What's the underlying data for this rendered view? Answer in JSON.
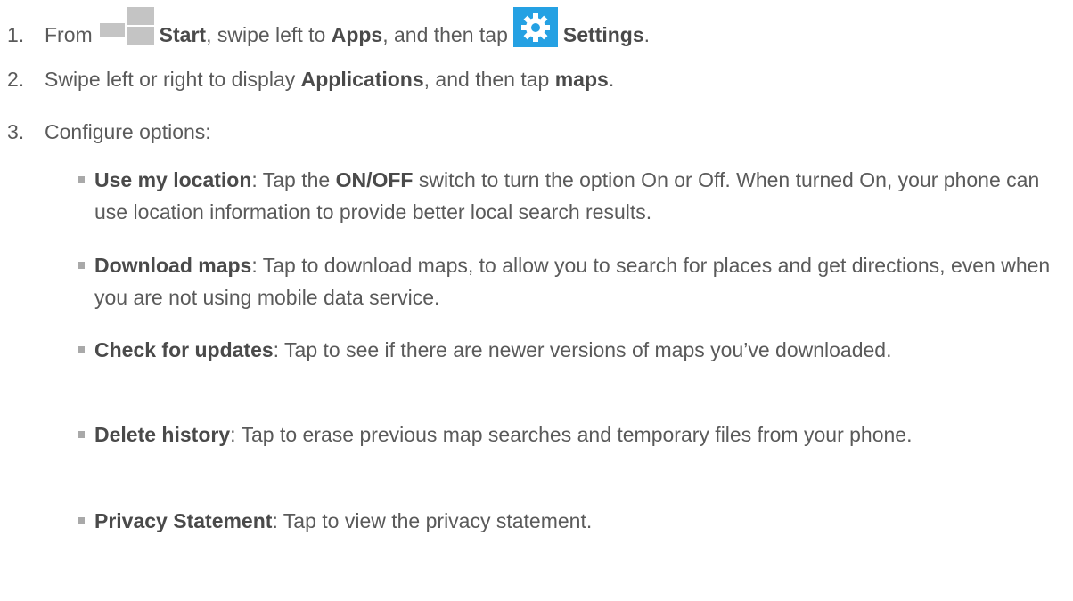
{
  "steps": [
    {
      "num": "1.",
      "t1": "From",
      "start": "Start",
      "t2": ", swipe left to",
      "apps": "Apps",
      "t3": ", and then tap",
      "settings": "Settings",
      "t4": "."
    },
    {
      "num": "2.",
      "t1": "Swipe left or right to display",
      "applications": "Applications",
      "t2": ", and then tap",
      "maps": "maps",
      "t3": "."
    },
    {
      "num": "3.",
      "t1": "Configure options:"
    }
  ],
  "options": [
    {
      "title": "Use my location",
      "pre": ": Tap the",
      "bold2": "ON/OFF",
      "desc": "switch to turn the option On or Off. When turned On, your phone can use location information to provide better local search results."
    },
    {
      "title": "Download maps",
      "desc": ": Tap to download maps, to allow you to search for places and get directions, even when you are not using mobile data service."
    },
    {
      "title": "Check for updates",
      "desc": ": Tap to see if there are newer versions of maps you’ve downloaded."
    },
    {
      "title": "Delete history",
      "desc": ": Tap to erase previous map searches and temporary files from your phone."
    },
    {
      "title": "Privacy Statement",
      "desc": ": Tap to view the privacy statement."
    }
  ],
  "icons": {
    "start": "windows-start-icon",
    "settings": "settings-gear-icon"
  },
  "colors": {
    "text": "#5a5a5a",
    "start_tile": "#c4c4c4",
    "settings_tile": "#25a1e3",
    "bullet": "#a9a9a9"
  }
}
